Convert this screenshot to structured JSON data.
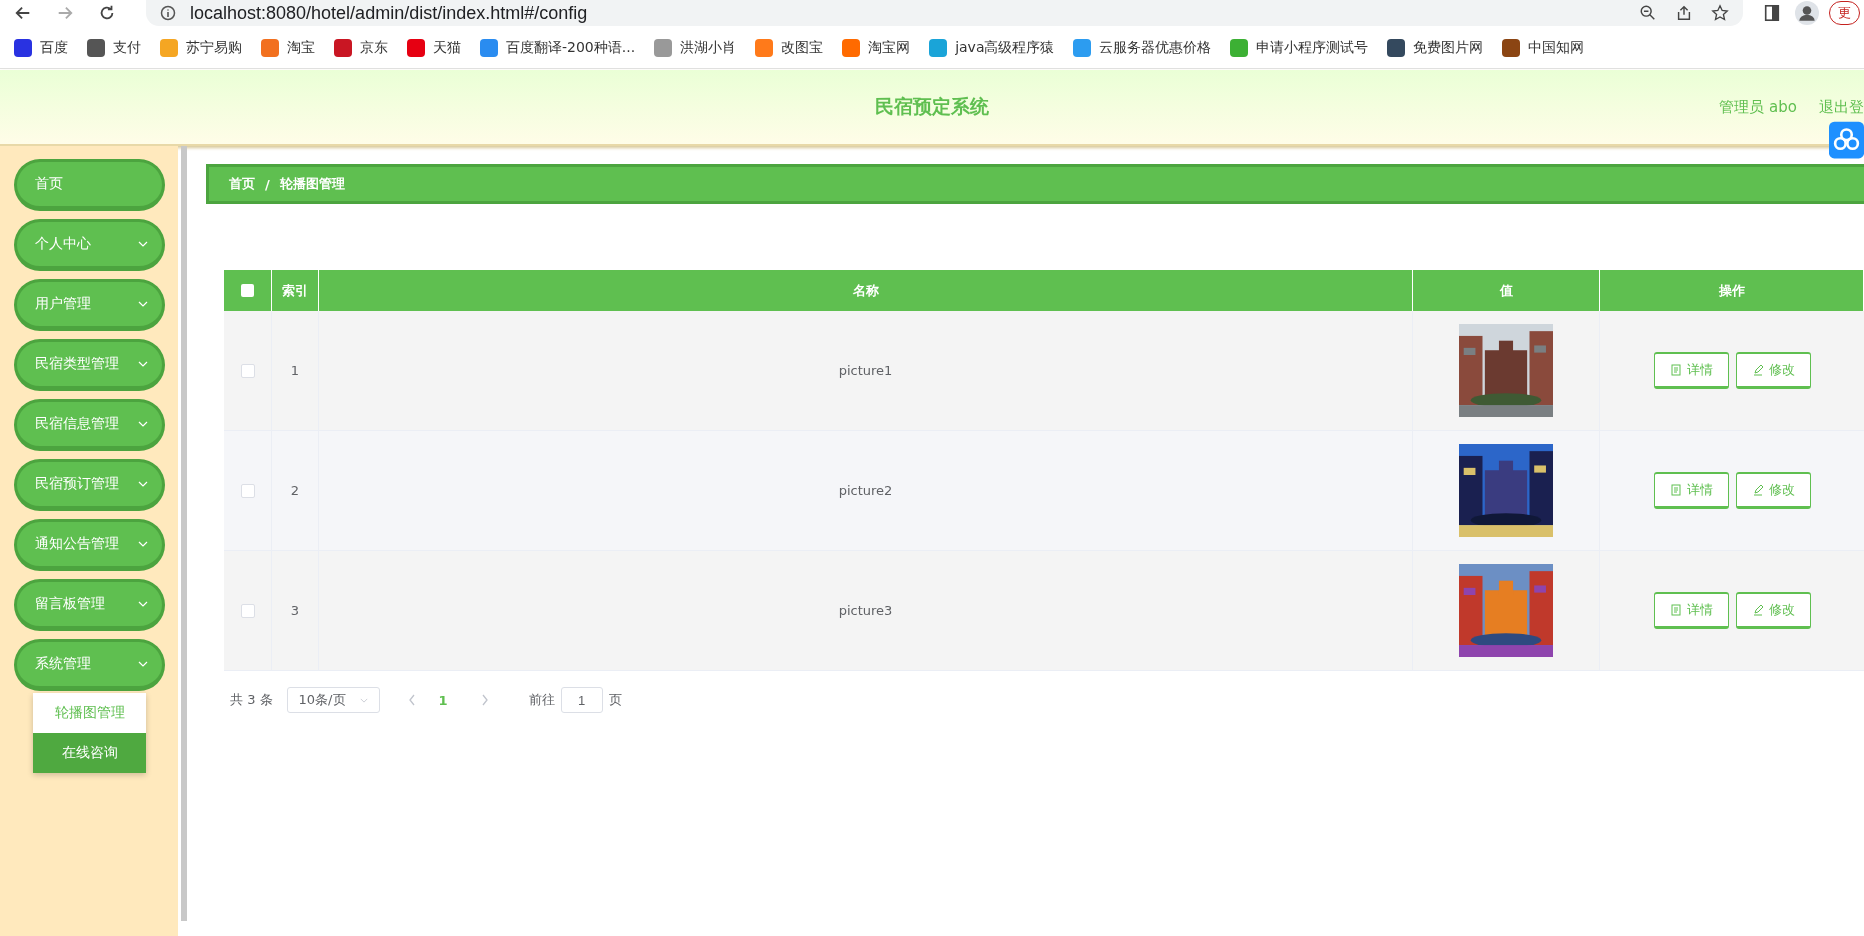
{
  "browser": {
    "url": "localhost:8080/hotel/admin/dist/index.html#/config",
    "update_label": "更",
    "bookmarks": [
      {
        "label": "百度",
        "color": "#2932e1"
      },
      {
        "label": "支付",
        "color": "#555555"
      },
      {
        "label": "苏宁易购",
        "color": "#f5a623"
      },
      {
        "label": "淘宝",
        "color": "#f2701f"
      },
      {
        "label": "京东",
        "color": "#c91623"
      },
      {
        "label": "天猫",
        "color": "#e60012"
      },
      {
        "label": "百度翻译-200种语...",
        "color": "#2a8cf0"
      },
      {
        "label": "洪湖小肖",
        "color": "#999999"
      },
      {
        "label": "改图宝",
        "color": "#ff7a1a"
      },
      {
        "label": "淘宝网",
        "color": "#ff6a00"
      },
      {
        "label": "java高级程序猿",
        "color": "#1aa4d8"
      },
      {
        "label": "云服务器优惠价格",
        "color": "#2c9cf0"
      },
      {
        "label": "申请小程序测试号",
        "color": "#3cb034"
      },
      {
        "label": "免费图片网",
        "color": "#34495e"
      },
      {
        "label": "中国知网",
        "color": "#8b4513"
      }
    ]
  },
  "header": {
    "title": "民宿预定系统",
    "user": "管理员 abo",
    "logout": "退出登"
  },
  "sidebar": {
    "items": [
      {
        "label": "首页",
        "kind": "link"
      },
      {
        "label": "个人中心",
        "kind": "submenu"
      },
      {
        "label": "用户管理",
        "kind": "submenu"
      },
      {
        "label": "民宿类型管理",
        "kind": "submenu"
      },
      {
        "label": "民宿信息管理",
        "kind": "submenu"
      },
      {
        "label": "民宿预订管理",
        "kind": "submenu"
      },
      {
        "label": "通知公告管理",
        "kind": "submenu"
      },
      {
        "label": "留言板管理",
        "kind": "submenu"
      },
      {
        "label": "系统管理",
        "kind": "submenu",
        "children": [
          {
            "label": "轮播图管理",
            "selected": true
          },
          {
            "label": "在线咨询",
            "selected": false
          }
        ]
      }
    ]
  },
  "breadcrumb": [
    "首页",
    "轮播图管理"
  ],
  "breadcrumb_separator": "/",
  "table": {
    "select_all_checked": false,
    "columns": [
      "索引",
      "名称",
      "值",
      "操作"
    ],
    "rows": [
      {
        "checked": false,
        "index": "1",
        "name": "picture1",
        "value": {
          "kind": "picture"
        },
        "actions": [
          "详情",
          "修改"
        ]
      },
      {
        "checked": false,
        "index": "2",
        "name": "picture2",
        "value": {
          "kind": "picture"
        },
        "actions": [
          "详情",
          "修改"
        ]
      },
      {
        "checked": false,
        "index": "3",
        "name": "picture3",
        "value": {
          "kind": "picture"
        },
        "actions": [
          "详情",
          "修改"
        ]
      }
    ]
  },
  "pagination": {
    "total": "共 3 条",
    "page_size": "10条/页",
    "pages": [
      {
        "label": "1",
        "selected": true
      }
    ],
    "goto_label": "前往",
    "goto_value": "1",
    "page_unit": "页"
  }
}
